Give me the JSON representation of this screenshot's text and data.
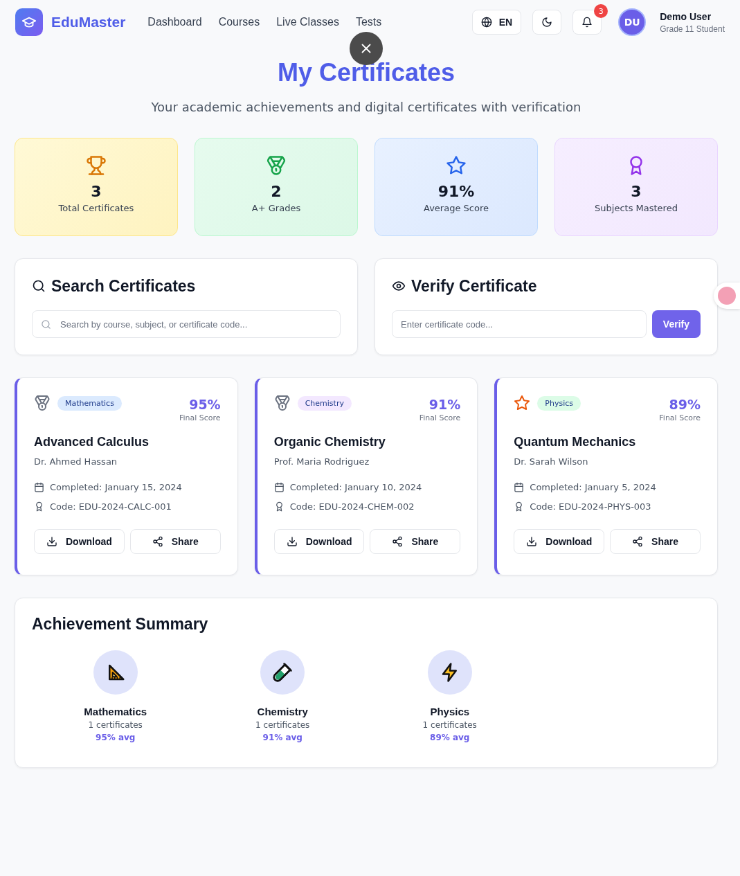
{
  "header": {
    "brand": "EduMaster",
    "nav": [
      {
        "label": "Dashboard"
      },
      {
        "label": "Courses"
      },
      {
        "label": "Live Classes"
      },
      {
        "label": "Tests"
      }
    ],
    "language": "EN",
    "notifications": "3",
    "user": {
      "initials": "DU",
      "name": "Demo User",
      "role": "Grade 11 Student"
    }
  },
  "title": "My Certificates",
  "subtitle": "Your academic achievements and digital certificates with verification",
  "stats": [
    {
      "kind": "trophy",
      "value": "3",
      "label": "Total Certificates"
    },
    {
      "kind": "medal",
      "value": "2",
      "label": "A+ Grades"
    },
    {
      "kind": "star",
      "value": "91%",
      "label": "Average Score"
    },
    {
      "kind": "award",
      "value": "3",
      "label": "Subjects Mastered"
    }
  ],
  "search": {
    "title": "Search Certificates",
    "placeholder": "Search by course, subject, or certificate code..."
  },
  "verify": {
    "title": "Verify Certificate",
    "placeholder": "Enter certificate code...",
    "button": "Verify"
  },
  "certificates": [
    {
      "kind": "medal",
      "subject": "Mathematics",
      "color": "#dbeafe",
      "score": "95%",
      "score_label": "Final Score",
      "course": "Advanced Calculus",
      "teacher": "Dr. Ahmed Hassan",
      "completed": "Completed: January 15, 2024",
      "code": "Code: EDU-2024-CALC-001",
      "download": "Download",
      "share": "Share"
    },
    {
      "kind": "medal",
      "subject": "Chemistry",
      "color": "#f3e8ff",
      "score": "91%",
      "score_label": "Final Score",
      "course": "Organic Chemistry",
      "teacher": "Prof. Maria Rodriguez",
      "completed": "Completed: January 10, 2024",
      "code": "Code: EDU-2024-CHEM-002",
      "download": "Download",
      "share": "Share"
    },
    {
      "kind": "star",
      "subject": "Physics",
      "color": "#dcfce7",
      "score": "89%",
      "score_label": "Final Score",
      "course": "Quantum Mechanics",
      "teacher": "Dr. Sarah Wilson",
      "completed": "Completed: January 5, 2024",
      "code": "Code: EDU-2024-PHYS-003",
      "download": "Download",
      "share": "Share"
    }
  ],
  "summary": {
    "title": "Achievement Summary",
    "items": [
      {
        "kind": "ruler",
        "subject": "Mathematics",
        "count": "1 certificates",
        "average": "95% avg"
      },
      {
        "kind": "tube",
        "subject": "Chemistry",
        "count": "1 certificates",
        "average": "91% avg"
      },
      {
        "kind": "bolt",
        "subject": "Physics",
        "count": "1 certificates",
        "average": "89% avg"
      }
    ]
  }
}
